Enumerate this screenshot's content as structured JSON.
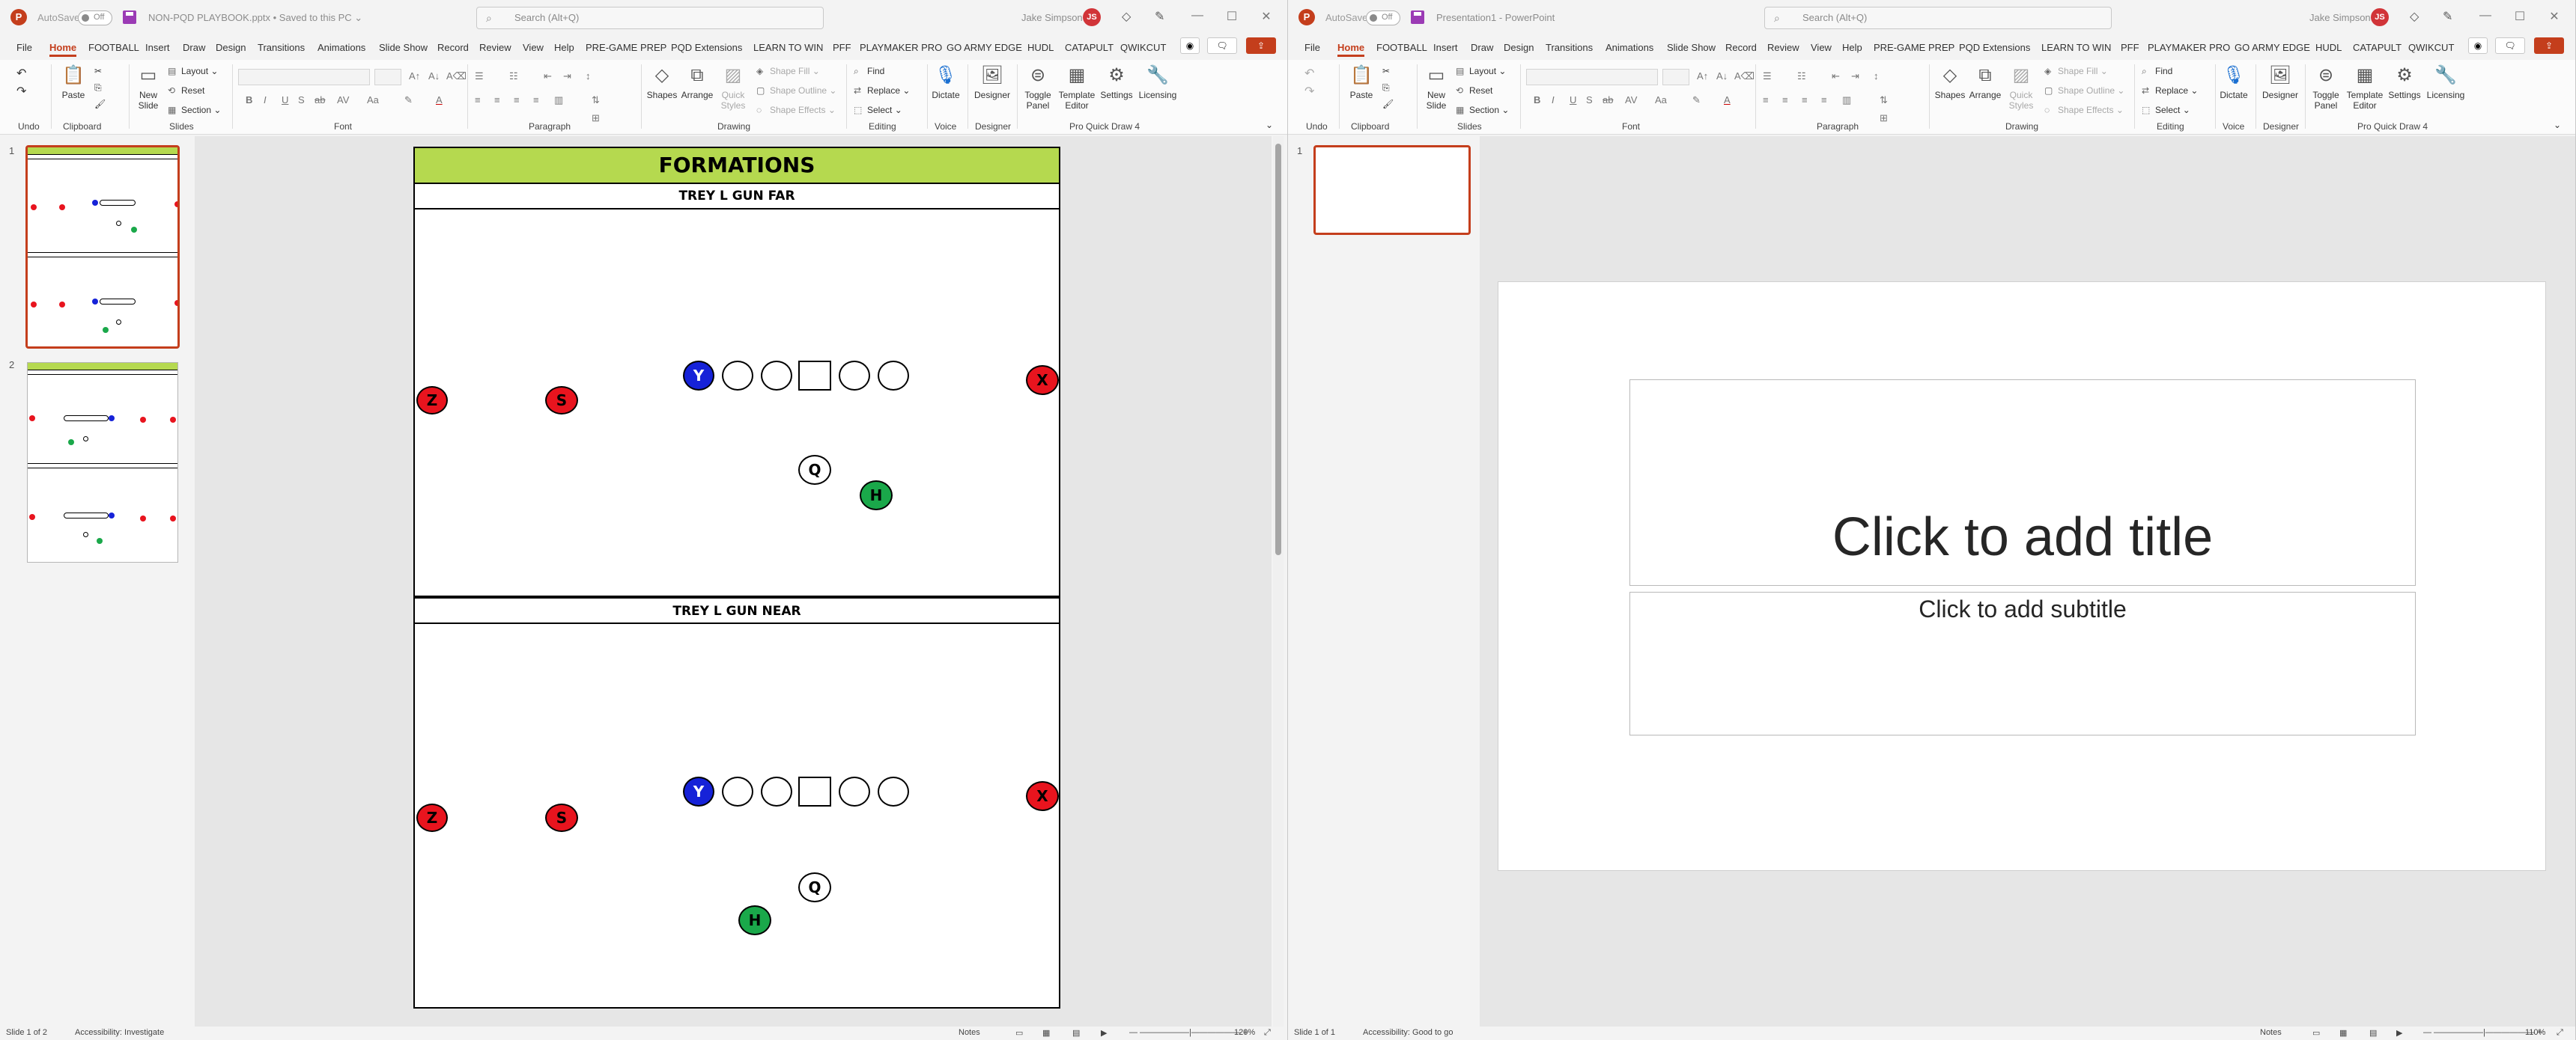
{
  "left_window": {
    "autosave_label": "AutoSave",
    "autosave_state": "Off",
    "document_title": "NON-PQD PLAYBOOK.pptx • Saved to this PC ⌄",
    "search_placeholder": "Search (Alt+Q)",
    "user_name": "Jake Simpson",
    "user_initials": "JS",
    "menu_tabs": [
      "File",
      "Home",
      "FOOTBALL",
      "Insert",
      "Draw",
      "Design",
      "Transitions",
      "Animations",
      "Slide Show",
      "Record",
      "Review",
      "View",
      "Help",
      "PRE-GAME PREP",
      "PQD Extensions",
      "LEARN TO WIN",
      "PFF",
      "PLAYMAKER PRO",
      "GO ARMY EDGE",
      "HUDL",
      "CATAPULT",
      "QWIKCUT"
    ],
    "ribbon": {
      "undo_group": "Undo",
      "clipboard_group": "Clipboard",
      "paste_label": "Paste",
      "slides_group": "Slides",
      "new_slide_label": "New Slide",
      "layout_label": "Layout",
      "reset_label": "Reset",
      "section_label": "Section",
      "font_group": "Font",
      "paragraph_group": "Paragraph",
      "drawing_group": "Drawing",
      "shapes_label": "Shapes",
      "arrange_label": "Arrange",
      "quick_styles_label": "Quick Styles",
      "shape_fill_label": "Shape Fill",
      "shape_outline_label": "Shape Outline",
      "shape_effects_label": "Shape Effects",
      "editing_group": "Editing",
      "find_label": "Find",
      "replace_label": "Replace",
      "select_label": "Select",
      "voice_group": "Voice",
      "dictate_label": "Dictate",
      "designer_group": "Designer",
      "designer_label": "Designer",
      "pqd_group": "Pro Quick Draw 4",
      "toggle_panel_label": "Toggle Panel",
      "template_editor_label": "Template Editor",
      "settings_label": "Settings",
      "licensing_label": "Licensing"
    },
    "thumbnails": [
      {
        "number": "1",
        "selected": true
      },
      {
        "number": "2",
        "selected": false
      }
    ],
    "slide": {
      "title": "FORMATIONS",
      "formations": [
        {
          "name": "TREY L GUN FAR",
          "h_position": "far"
        },
        {
          "name": "TREY L GUN NEAR",
          "h_position": "near"
        }
      ],
      "players": {
        "z": "Z",
        "s": "S",
        "y": "Y",
        "x": "X",
        "q": "Q",
        "h": "H"
      }
    },
    "status": {
      "slide_count": "Slide 1 of 2",
      "accessibility": "Accessibility: Investigate",
      "notes": "Notes",
      "zoom": "120%"
    }
  },
  "right_window": {
    "autosave_label": "AutoSave",
    "autosave_state": "Off",
    "document_title": "Presentation1 - PowerPoint",
    "search_placeholder": "Search (Alt+Q)",
    "user_name": "Jake Simpson",
    "user_initials": "JS",
    "menu_tabs": [
      "File",
      "Home",
      "FOOTBALL",
      "Insert",
      "Draw",
      "Design",
      "Transitions",
      "Animations",
      "Slide Show",
      "Record",
      "Review",
      "View",
      "Help",
      "PRE-GAME PREP",
      "PQD Extensions",
      "LEARN TO WIN",
      "PFF",
      "PLAYMAKER PRO",
      "GO ARMY EDGE",
      "HUDL",
      "CATAPULT",
      "QWIKCUT"
    ],
    "thumbnails": [
      {
        "number": "1",
        "selected": true
      }
    ],
    "slide": {
      "title_placeholder": "Click to add title",
      "subtitle_placeholder": "Click to add subtitle"
    },
    "status": {
      "slide_count": "Slide 1 of 1",
      "accessibility": "Accessibility: Good to go",
      "notes": "Notes",
      "zoom": "110%"
    }
  },
  "colors": {
    "accent": "#c43e1c",
    "formation_header": "#b5d94f",
    "player_red": "#e8141e",
    "player_blue": "#1622d8",
    "player_green": "#1aa84a"
  }
}
